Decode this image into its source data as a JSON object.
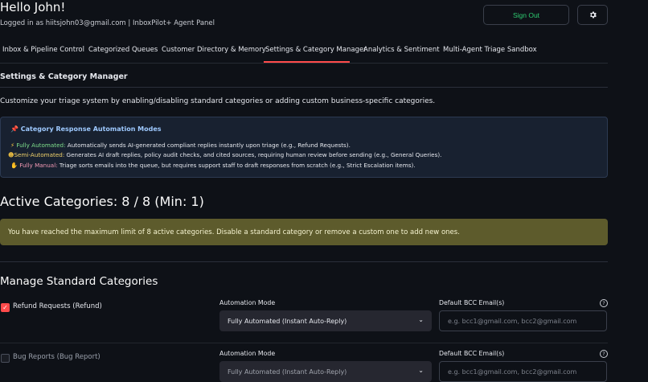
{
  "header": {
    "greeting": "Hello John!",
    "logged_in_line": "Logged in as hiitsjohn03@gmail.com | InboxPilot+ Agent Panel",
    "signout_label": "Sign Out",
    "gear_icon": "gear-icon"
  },
  "tabs": [
    {
      "label": "Inbox & Pipeline Control"
    },
    {
      "label": "Categorized Queues"
    },
    {
      "label": "Customer Directory & Memory"
    },
    {
      "label": "Settings & Category Manager"
    },
    {
      "label": "Analytics & Sentiment"
    },
    {
      "label": "Multi-Agent Triage Sandbox"
    }
  ],
  "active_tab": "Settings & Category Manager",
  "settings": {
    "header": "Settings & Category Manager",
    "description": "Customize your triage system by enabling/disabling standard categories or adding custom business-specific categories.",
    "info": {
      "title": "Category Response Automation Modes",
      "lines": [
        {
          "icon": "⚡",
          "label": "Fully Automated:",
          "text": " Automatically sends AI-generated compliant replies instantly upon triage (e.g., Refund Requests)."
        },
        {
          "icon": "☻",
          "label": "Semi-Automated:",
          "text": " Generates AI draft replies, policy audit checks, and cited sources, requiring human review before sending (e.g., General Queries)."
        },
        {
          "icon": "✋",
          "label": "Fully Manual:",
          "text": " Triage sorts emails into the queue, but requires support staff to draft responses from scratch (e.g., Strict Escalation items)."
        }
      ]
    },
    "active_title": "Active Categories: 8 / 8 (Min: 1)",
    "warning": "You have reached the maximum limit of 8 active categories. Disable a standard category or remove a custom one to add new ones.",
    "manage_title": "Manage Standard Categories",
    "categories": [
      {
        "label": "Refund Requests (Refund)",
        "checked": true,
        "mode_label": "Automation Mode",
        "mode_value": "Fully Automated (Instant Auto-Reply)",
        "bcc_label": "Default BCC Email(s)",
        "bcc_placeholder": "e.g. bcc1@gmail.com, bcc2@gmail.com"
      },
      {
        "label": "Bug Reports (Bug Report)",
        "checked": false,
        "mode_label": "Automation Mode",
        "mode_value": "Fully Automated (Instant Auto-Reply)",
        "bcc_label": "Default BCC Email(s)",
        "bcc_placeholder": "e.g. bcc1@gmail.com, bcc2@gmail.com"
      }
    ]
  },
  "colors": {
    "background": "#0e1117",
    "accent": "#ff4b4b",
    "signout_text": "#2ecc71",
    "info_bg": "#182130",
    "warning_bg": "#5d5b2c"
  }
}
